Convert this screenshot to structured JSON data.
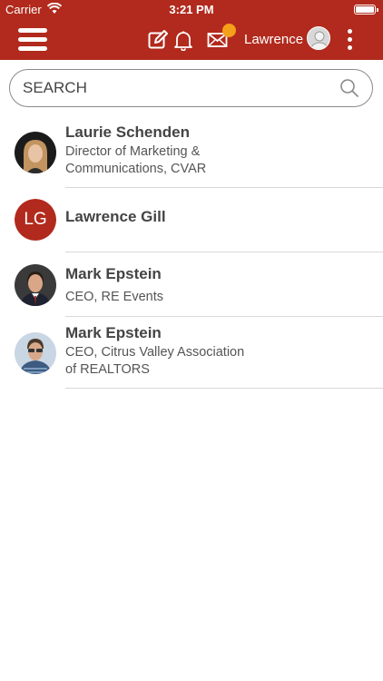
{
  "status_bar": {
    "carrier": "Carrier",
    "time": "3:21 PM"
  },
  "nav": {
    "user_name": "Lawrence",
    "icons": [
      "menu-icon",
      "compose-icon",
      "bell-icon",
      "mail-icon",
      "avatar-icon",
      "more-icon"
    ],
    "accent_color": "#b12a1d",
    "badge_color": "#f5a01a"
  },
  "search": {
    "placeholder": "SEARCH"
  },
  "contacts": [
    {
      "name": "Laurie Schenden",
      "title_line1": "Director of Marketing &",
      "title_line2": "Communications, CVAR",
      "avatar": "photo"
    },
    {
      "name": "Lawrence Gill",
      "initials": "LG",
      "avatar": "initials"
    },
    {
      "name": "Mark Epstein",
      "title_line1": "CEO, RE Events",
      "title_line2": "",
      "avatar": "photo"
    },
    {
      "name": "Mark Epstein",
      "title_line1": "CEO, Citrus Valley Association",
      "title_line2": "of REALTORS",
      "avatar": "photo"
    }
  ]
}
